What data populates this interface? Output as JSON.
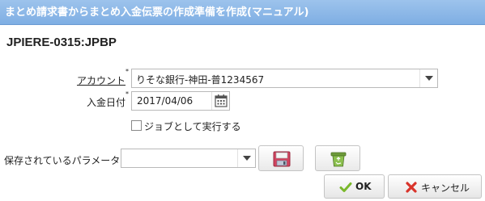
{
  "dialog": {
    "title": "まとめ請求書からまとめ入金伝票の作成準備を作成(マニュアル)",
    "code_heading": "JPIERE-0315:JPBP"
  },
  "form": {
    "account_label": "アカウント",
    "account_required_mark": "*",
    "account_value": "りそな銀行-神田-普1234567",
    "date_label": "入金日付",
    "date_required_mark": "*",
    "date_value": "2017/04/06",
    "run_as_job_label": "ジョブとして実行する",
    "run_as_job_checked": false,
    "saved_params_label": "保存されているパラメータ",
    "saved_params_value": ""
  },
  "buttons": {
    "ok_label": "OK",
    "cancel_label": "キャンセル"
  },
  "icons": {
    "account_dropdown": "chevron-down-icon",
    "date_picker": "calendar-icon",
    "params_dropdown": "chevron-down-icon",
    "save_params": "floppy-disk-icon",
    "delete_params": "recycle-bin-icon",
    "ok": "checkmark-icon",
    "cancel": "x-mark-icon"
  },
  "colors": {
    "titlebar": "#8ab6e8",
    "ok_icon": "#7ab82b",
    "cancel_icon": "#d9342b"
  }
}
